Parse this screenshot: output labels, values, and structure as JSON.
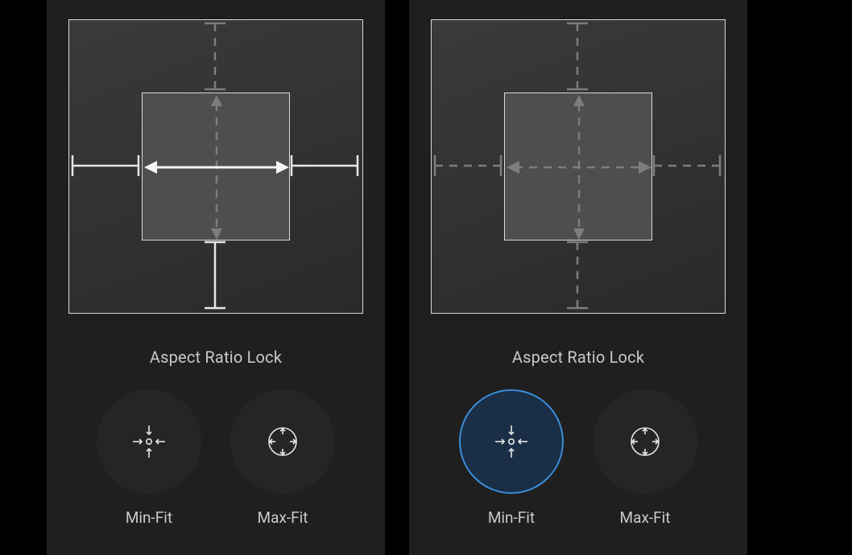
{
  "panels": [
    {
      "sectionLabel": "Aspect Ratio Lock",
      "previewMode": "horizontal-active",
      "buttons": [
        {
          "label": "Min-Fit",
          "icon": "min-fit-icon",
          "selected": false
        },
        {
          "label": "Max-Fit",
          "icon": "max-fit-icon",
          "selected": false
        }
      ]
    },
    {
      "sectionLabel": "Aspect Ratio Lock",
      "previewMode": "all-dimmed",
      "buttons": [
        {
          "label": "Min-Fit",
          "icon": "min-fit-icon",
          "selected": true
        },
        {
          "label": "Max-Fit",
          "icon": "max-fit-icon",
          "selected": false
        }
      ]
    }
  ]
}
